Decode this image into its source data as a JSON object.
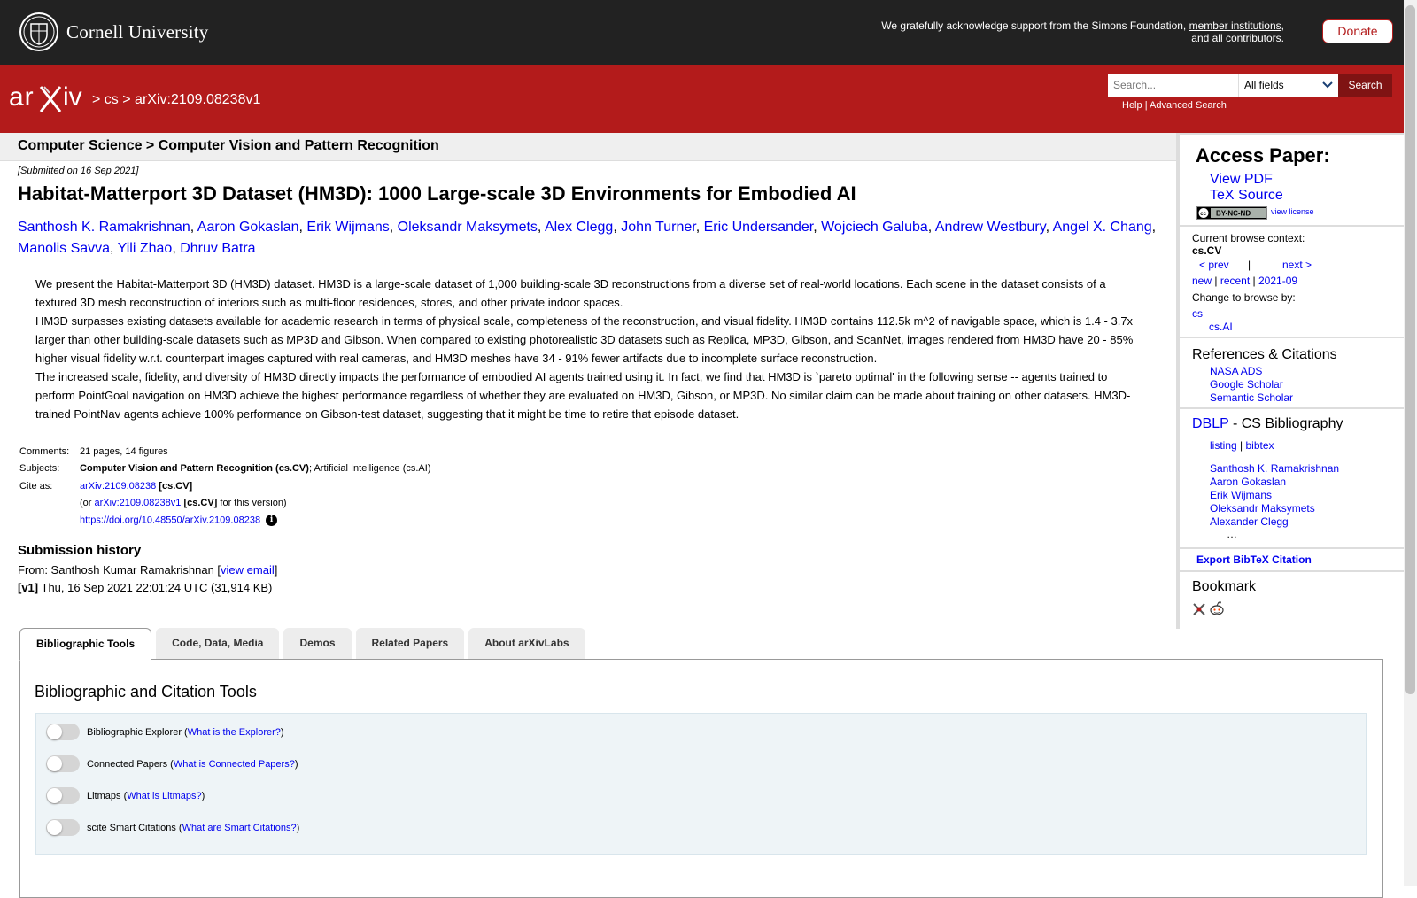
{
  "cornell": {
    "name": "Cornell University",
    "ack_text": "We gratefully acknowledge support from the Simons Foundation,",
    "ack_link": "member institutions",
    "ack_end": ", and all contributors.",
    "donate_label": "Donate"
  },
  "arxiv_bar": {
    "breadcrumb_sep1": ">",
    "breadcrumb_cs": "cs",
    "breadcrumb_sep2": ">",
    "breadcrumb_id": "arXiv:2109.08238v1",
    "search_placeholder": "Search...",
    "search_field": "All fields",
    "search_button": "Search",
    "help": "Help",
    "help_sep": "|",
    "advanced": "Advanced Search"
  },
  "subject_header": "Computer Science > Computer Vision and Pattern Recognition",
  "submitted": "[Submitted on 16 Sep 2021]",
  "title": "Habitat-Matterport 3D Dataset (HM3D): 1000 Large-scale 3D Environments for Embodied AI",
  "authors": [
    "Santhosh K. Ramakrishnan",
    "Aaron Gokaslan",
    "Erik Wijmans",
    "Oleksandr Maksymets",
    "Alex Clegg",
    "John Turner",
    "Eric Undersander",
    "Wojciech Galuba",
    "Andrew Westbury",
    "Angel X. Chang",
    "Manolis Savva",
    "Yili Zhao",
    "Dhruv Batra"
  ],
  "abstract": [
    "We present the Habitat-Matterport 3D (HM3D) dataset. HM3D is a large-scale dataset of 1,000 building-scale 3D reconstructions from a diverse set of real-world locations. Each scene in the dataset consists of a textured 3D mesh reconstruction of interiors such as multi-floor residences, stores, and other private indoor spaces.",
    "HM3D surpasses existing datasets available for academic research in terms of physical scale, completeness of the reconstruction, and visual fidelity. HM3D contains 112.5k m^2 of navigable space, which is 1.4 - 3.7x larger than other building-scale datasets such as MP3D and Gibson. When compared to existing photorealistic 3D datasets such as Replica, MP3D, Gibson, and ScanNet, images rendered from HM3D have 20 - 85% higher visual fidelity w.r.t. counterpart images captured with real cameras, and HM3D meshes have 34 - 91% fewer artifacts due to incomplete surface reconstruction.",
    "The increased scale, fidelity, and diversity of HM3D directly impacts the performance of embodied AI agents trained using it. In fact, we find that HM3D is `pareto optimal' in the following sense -- agents trained to perform PointGoal navigation on HM3D achieve the highest performance regardless of whether they are evaluated on HM3D, Gibson, or MP3D. No similar claim can be made about training on other datasets. HM3D-trained PointNav agents achieve 100% performance on Gibson-test dataset, suggesting that it might be time to retire that episode dataset."
  ],
  "meta": {
    "comments_label": "Comments:",
    "comments": "21 pages, 14 figures",
    "subjects_label": "Subjects:",
    "subject_primary": "Computer Vision and Pattern Recognition (cs.CV)",
    "subject_secondary": "; Artificial Intelligence (cs.AI)",
    "cite_label": "Cite as:",
    "cite_id": "arXiv:2109.08238",
    "cite_cat": "[cs.CV]",
    "cite_or": "(or",
    "cite_version_id": "arXiv:2109.08238v1",
    "cite_version_cat": "[cs.CV]",
    "cite_version_suffix": "for this version)",
    "doi": "https://doi.org/10.48550/arXiv.2109.08238",
    "info_icon": "i"
  },
  "history": {
    "title": "Submission history",
    "from_prefix": "From: Santhosh Kumar Ramakrishnan [",
    "view_email": "view email",
    "from_suffix": "]",
    "v1_label": "[v1]",
    "v1_text": " Thu, 16 Sep 2021 22:01:24 UTC (31,914 KB)"
  },
  "tabs": [
    "Bibliographic Tools",
    "Code, Data, Media",
    "Demos",
    "Related Papers",
    "About arXivLabs"
  ],
  "panel": {
    "title": "Bibliographic and Citation Tools",
    "toggles": [
      {
        "label": "Bibliographic Explorer",
        "link": "What is the Explorer?"
      },
      {
        "label": "Connected Papers",
        "link": "What is Connected Papers?"
      },
      {
        "label": "Litmaps",
        "link": "What is Litmaps?"
      },
      {
        "label": "scite Smart Citations",
        "link": "What are Smart Citations?"
      }
    ]
  },
  "sidebar": {
    "access_title": "Access Paper:",
    "view_pdf": "View PDF",
    "tex_source": "TeX Source",
    "cc_badge": "BY-NC-ND",
    "view_license": "view license",
    "browse_label": "Current browse context:",
    "browse_context": "cs.CV",
    "prev": "< prev",
    "sep": "|",
    "next": "next >",
    "nav_new": "new",
    "nav_recent": "recent",
    "nav_month": "2021-09",
    "change_label": "Change to browse by:",
    "cs": "cs",
    "csai": "cs.AI",
    "refs_title": "References & Citations",
    "refs": [
      "NASA ADS",
      "Google Scholar",
      "Semantic Scholar"
    ],
    "dblp": "DBLP",
    "dblp_rest": " - CS Bibliography",
    "listing": "listing",
    "bibtex": "bibtex",
    "dblp_authors": [
      "Santhosh K. Ramakrishnan",
      "Aaron Gokaslan",
      "Erik Wijmans",
      "Oleksandr Maksymets",
      "Alexander Clegg"
    ],
    "ellipsis": "…",
    "export": "Export BibTeX Citation",
    "bookmark_title": "Bookmark"
  },
  "colors": {
    "arxiv_red": "#b31b1b",
    "dark_red": "#7f1313",
    "cornell_bar": "#222222",
    "link": "#0000ee"
  }
}
